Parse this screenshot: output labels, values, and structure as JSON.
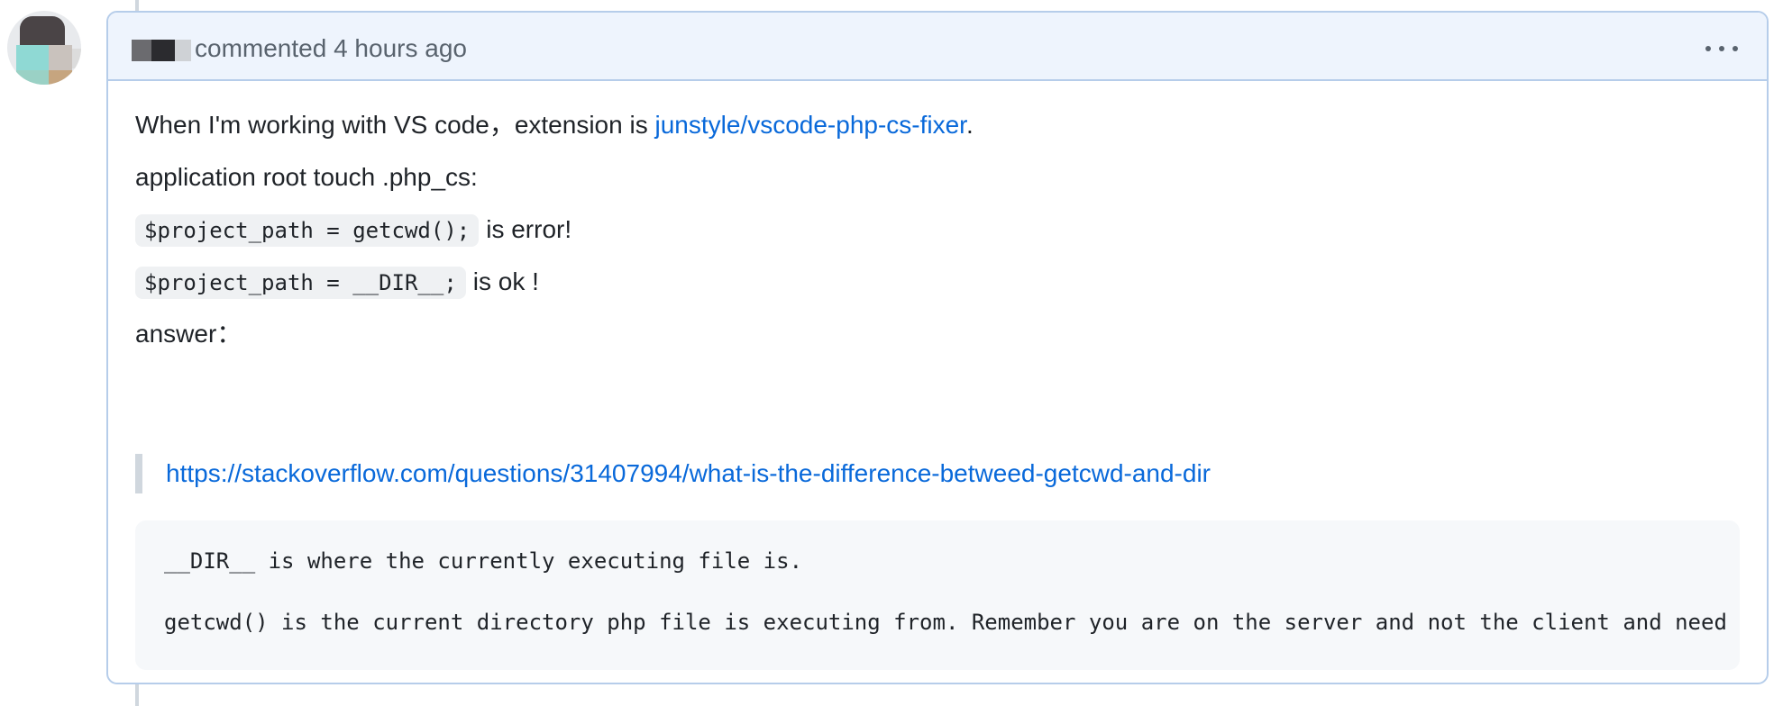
{
  "comment": {
    "header": {
      "action_text": "commented 4 hours ago",
      "menu_icon": "kebab-horizontal-icon"
    },
    "body": {
      "line1_prefix": "When I'm working with VS code，extension is ",
      "line1_link": "junstyle/vscode-php-cs-fixer",
      "line1_suffix": ".",
      "line2": "application root touch .php_cs:",
      "line3_code": "$project_path = getcwd();",
      "line3_text": "is error!",
      "line4_code": "$project_path = __DIR__;",
      "line4_text": "is ok !",
      "line5": "answer：",
      "quote_link": "https://stackoverflow.com/questions/31407994/what-is-the-difference-betweed-getcwd-and-dir",
      "code_block": [
        "__DIR__ is where the currently executing file is.",
        "getcwd() is the current directory php file is executing from. Remember you are on the server and not the client and need to"
      ]
    }
  },
  "colors": {
    "link": "#0969da",
    "header_bg": "#eef4fd",
    "border": "#b6cdea",
    "code_bg": "#f6f8fa"
  }
}
